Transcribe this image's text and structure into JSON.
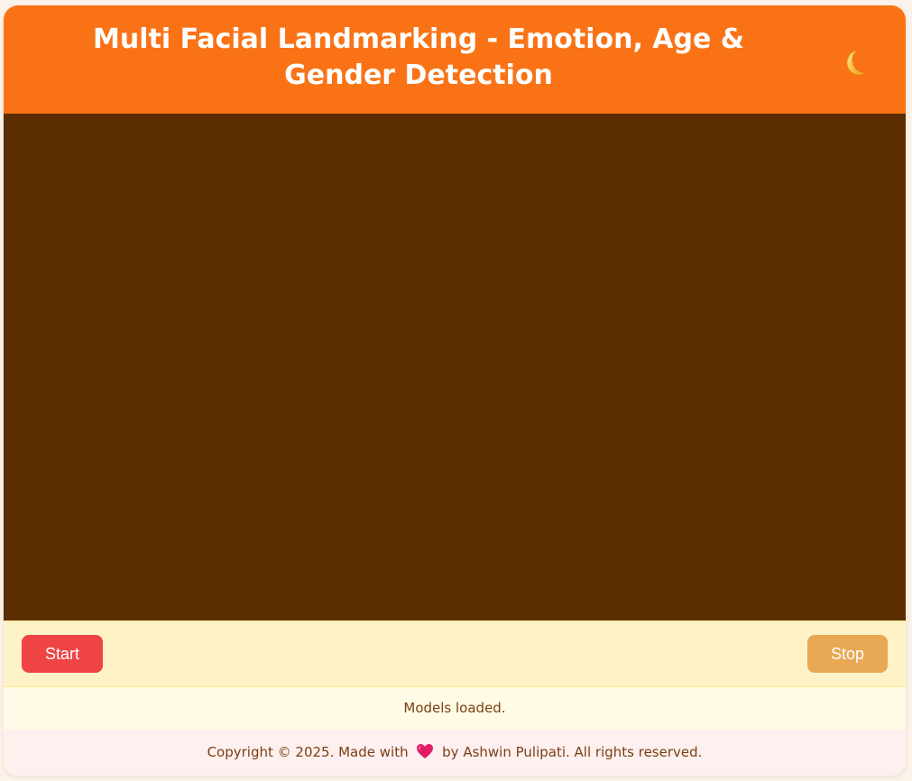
{
  "header": {
    "title": "Multi Facial Landmarking - Emotion, Age & Gender Detection",
    "theme_toggle_icon": "moon-icon"
  },
  "controls": {
    "start_label": "Start",
    "stop_label": "Stop"
  },
  "status": {
    "text": "Models loaded."
  },
  "footer": {
    "prefix": "Copyright © 2025. Made with",
    "heart_icon": "heart-icon",
    "suffix": "by Ashwin Pulipati. All rights reserved."
  },
  "colors": {
    "header_bg": "#f97316",
    "video_bg": "#5c2d00",
    "start_button": "#ef4444",
    "stop_button": "#e8a854",
    "controls_bg": "#fef3c7",
    "footer_bg": "#fff0f0",
    "text": "#7a3e12"
  }
}
